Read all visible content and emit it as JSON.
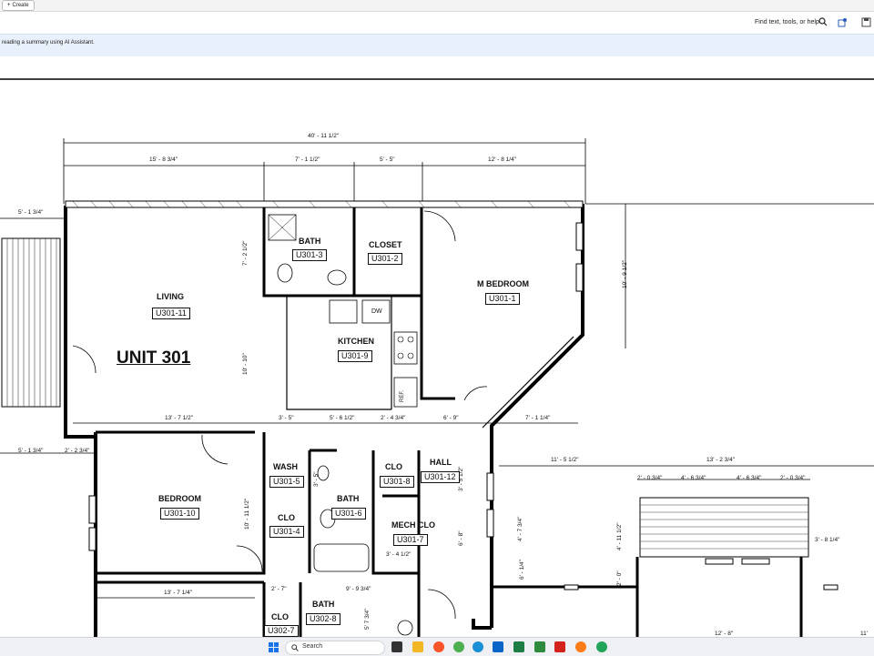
{
  "app": {
    "create_label": "Create",
    "find_label": "Find text, tools, or help",
    "banner_text": "reading a summary using AI Assistant."
  },
  "plan": {
    "unit_title": "UNIT 301",
    "rooms": [
      {
        "name": "LIVING",
        "id": "U301-11"
      },
      {
        "name": "BATH",
        "id": "U301-3"
      },
      {
        "name": "CLOSET",
        "id": "U301-2"
      },
      {
        "name": "M BEDROOM",
        "id": "U301-1"
      },
      {
        "name": "KITCHEN",
        "id": "U301-9"
      },
      {
        "name": "BEDROOM",
        "id": "U301-10"
      },
      {
        "name": "WASH",
        "id": "U301-5"
      },
      {
        "name": "CLO",
        "id": "U301-4"
      },
      {
        "name": "BATH",
        "id": "U301-6"
      },
      {
        "name": "CLO",
        "id": "U301-8"
      },
      {
        "name": "HALL",
        "id": "U301-12"
      },
      {
        "name": "MECH CLO",
        "id": "U301-7"
      },
      {
        "name": "CLO",
        "id": "U302-7"
      },
      {
        "name": "BATH",
        "id": "U302-8"
      }
    ],
    "fixtures": {
      "dw": "DW",
      "ref": "REF."
    },
    "dimensions": {
      "overall": "40' - 11 1/2\"",
      "d1": "15' - 8 3/4\"",
      "d2": "7' - 1 1/2\"",
      "d3": "5' - 5\"",
      "d4": "12' - 8 1/4\"",
      "d5": "5' - 1 3/4\"",
      "d6": "10' - 9 1/2\"",
      "d7": "7' - 2 1/2\"",
      "d8": "10' - 10\"",
      "d9": "13' - 7 1/2\"",
      "d10": "3' - 5\"",
      "d11": "5' - 6 1/2\"",
      "d12": "2' - 4 3/4\"",
      "d13": "6' - 9\"",
      "d14": "7' - 1 1/4\"",
      "d15": "5' - 1 3/4\"",
      "d16": "2' - 2 3/4\"",
      "d17": "11' - 5 1/2\"",
      "d18": "13' - 2 3/4\"",
      "d19": "2' - 0 3/4\"",
      "d20": "4' - 6 3/4\"",
      "d21": "4' - 6 3/4\"",
      "d22": "2' - 0 3/4\"",
      "d23": "3' - 8 1/4\"",
      "d24": "10' - 11 1/2\"",
      "d25": "3' - 5\"",
      "d26": "3' - 5 1/2\"",
      "d27": "6' - 8\"",
      "d28": "4' - 7 3/4\"",
      "d29": "3' - 4 1/2\"",
      "d30": "4' - 11 1/2\"",
      "d31": "6' - 1/4\"",
      "d32": "2' - 0\"",
      "d33": "13' - 7 1/4\"",
      "d34": "2' - 7\"",
      "d35": "9' - 9 3/4\"",
      "d36": "5' 7 3/4\"",
      "d37": "12' - 8\"",
      "d38": "11'"
    }
  },
  "taskbar": {
    "search_label": "Search"
  }
}
